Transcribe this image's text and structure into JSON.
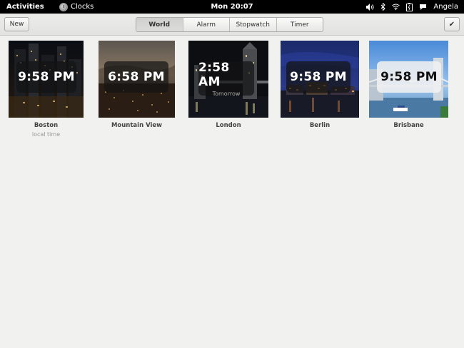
{
  "topbar": {
    "activities": "Activities",
    "app_name": "Clocks",
    "clock": "Mon 20:07",
    "user": "Angela"
  },
  "header": {
    "new_label": "New",
    "done_icon": "✔",
    "tabs": [
      {
        "label": "World",
        "active": true
      },
      {
        "label": "Alarm",
        "active": false
      },
      {
        "label": "Stopwatch",
        "active": false
      },
      {
        "label": "Timer",
        "active": false
      }
    ]
  },
  "clocks": [
    {
      "city": "Boston",
      "time": "9:58 PM",
      "subtitle": "",
      "note": "local time",
      "theme": "dark"
    },
    {
      "city": "Mountain View",
      "time": "6:58 PM",
      "subtitle": "",
      "note": "",
      "theme": "dark"
    },
    {
      "city": "London",
      "time": "2:58 AM",
      "subtitle": "Tomorrow",
      "note": "",
      "theme": "dark"
    },
    {
      "city": "Berlin",
      "time": "9:58 PM",
      "subtitle": "",
      "note": "",
      "theme": "dark"
    },
    {
      "city": "Brisbane",
      "time": "9:58 PM",
      "subtitle": "",
      "note": "",
      "theme": "light"
    }
  ]
}
